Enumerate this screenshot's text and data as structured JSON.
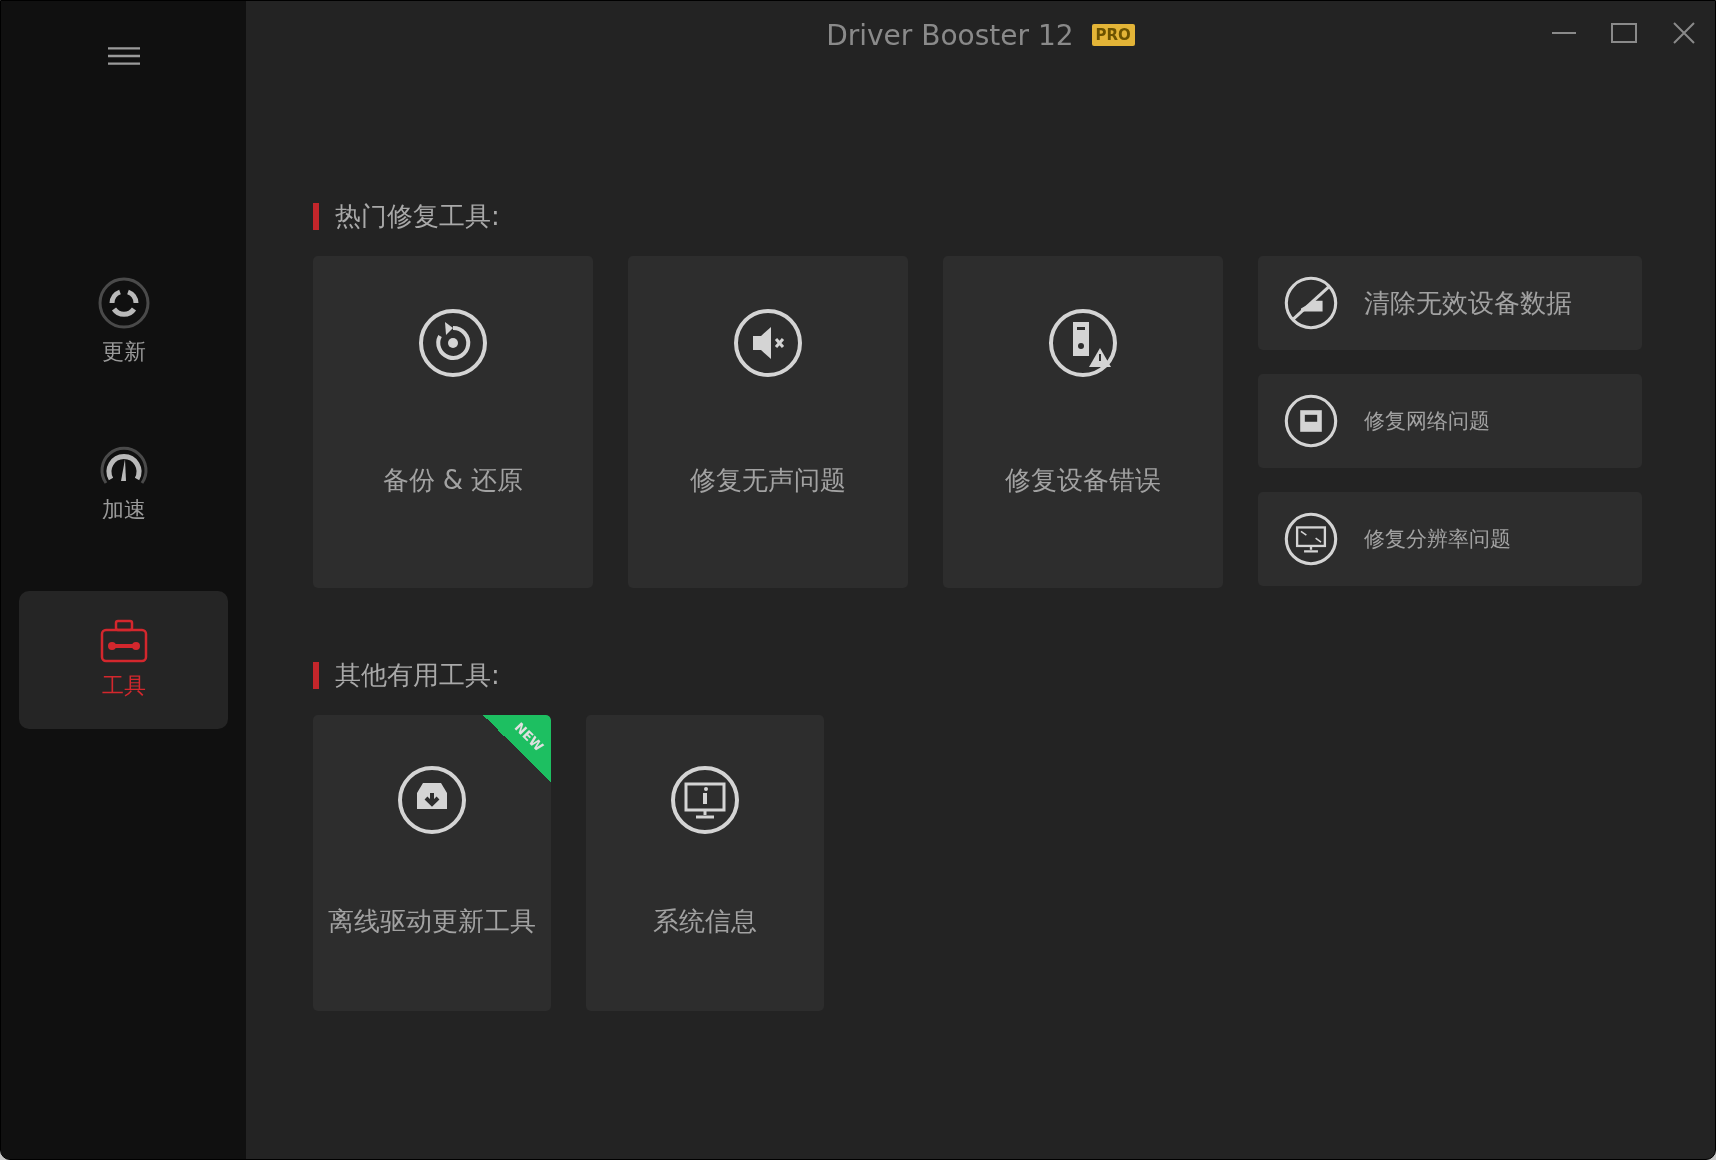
{
  "window": {
    "title": "Driver Booster 12",
    "badge": "PRO"
  },
  "sidebar": {
    "items": [
      {
        "label": "更新",
        "selected": false
      },
      {
        "label": "加速",
        "selected": false
      },
      {
        "label": "工具",
        "selected": true
      }
    ]
  },
  "sections": [
    {
      "title": "热门修复工具:",
      "tiles": [
        {
          "kind": "large",
          "label": "备份 & 还原"
        },
        {
          "kind": "large",
          "label": "修复无声问题"
        },
        {
          "kind": "large",
          "label": "修复设备错误"
        },
        {
          "kind": "row",
          "label": "清除无效设备数据"
        },
        {
          "kind": "row",
          "label": "修复网络问题"
        },
        {
          "kind": "row",
          "label": "修复分辨率问题"
        }
      ]
    },
    {
      "title": "其他有用工具:",
      "tiles": [
        {
          "kind": "large",
          "label": "离线驱动更新工具",
          "badge": "NEW"
        },
        {
          "kind": "large",
          "label": "系统信息"
        }
      ]
    }
  ]
}
